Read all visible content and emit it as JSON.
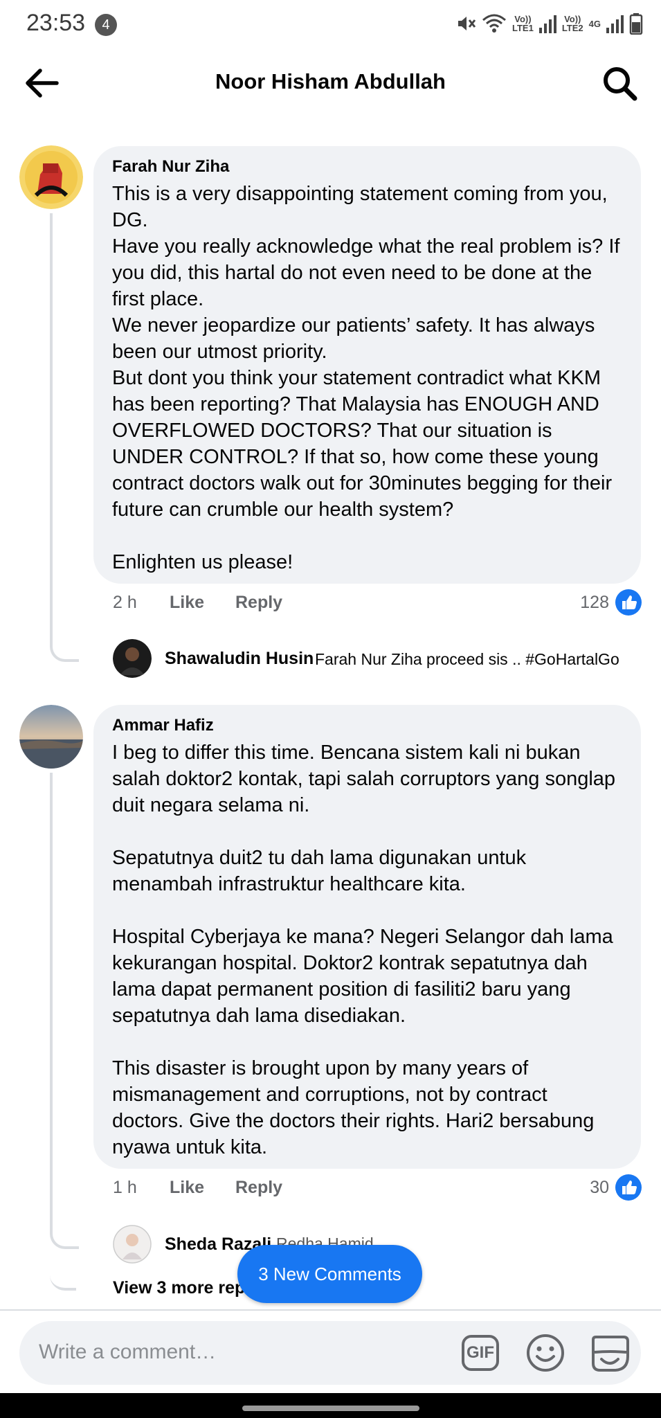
{
  "status_bar": {
    "time": "23:53",
    "notification_count": "4",
    "sim1_label_top": "Vo))",
    "sim1_label_bottom": "LTE1",
    "sim2_label_top": "Vo))",
    "sim2_label_bottom": "LTE2",
    "network_type": "4G",
    "icons": [
      "mute-icon",
      "wifi-icon",
      "signal-icon",
      "battery-icon"
    ]
  },
  "header": {
    "title": "Noor Hisham Abdullah",
    "back_icon": "arrow-left-icon",
    "search_icon": "search-icon"
  },
  "comments": [
    {
      "author": "Farah Nur Ziha",
      "text": "This is a very disappointing statement coming from you, DG.\nHave you really acknowledge what the real problem is? If you did, this hartal do not even need to be done at the first place.\nWe never jeopardize our patients’ safety. It has always been our utmost priority.\nBut dont you think your statement contradict what KKM has been reporting? That Malaysia has ENOUGH AND OVERFLOWED DOCTORS? That our situation is UNDER CONTROL? If that so, how come these young contract doctors walk out for 30minutes begging for their future can crumble our health system?\n\nEnlighten us please!",
      "time": "2 h",
      "like_label": "Like",
      "reply_label": "Reply",
      "reaction_count": "128",
      "reply_preview": {
        "author": "Shawaludin Husin",
        "text": "Farah Nur Ziha proceed sis  .. #GoHartalGo"
      }
    },
    {
      "author": "Ammar Hafiz",
      "text": "I beg to differ this time. Bencana sistem kali ni bukan salah doktor2 kontak, tapi salah corruptors yang songlap duit negara selama ni.\n\nSepatutnya duit2 tu dah lama digunakan untuk menambah infrastruktur healthcare kita.\n\nHospital Cyberjaya ke mana? Negeri Selangor dah lama kekurangan hospital. Doktor2 kontrak sepatutnya dah lama dapat permanent position di fasiliti2 baru yang sepatutnya dah lama disediakan.\n\nThis disaster is brought upon by many years of mismanagement and corruptions, not by contract doctors. Give the doctors their rights. Hari2 bersabung nyawa untuk kita.",
      "time": "1 h",
      "like_label": "Like",
      "reply_label": "Reply",
      "reaction_count": "30",
      "reply_preview": {
        "author": "Sheda Razali",
        "text": "Redha Hamid"
      },
      "view_more_label": "View 3 more rep"
    }
  ],
  "new_comments_pill": "3 New Comments",
  "composer": {
    "placeholder": "Write a comment…",
    "gif_label": "GIF",
    "icons": [
      "gif-icon",
      "emoji-icon",
      "sticker-icon"
    ]
  },
  "colors": {
    "accent": "#1877f2",
    "bubble": "#f0f2f5",
    "secondary_text": "#65676b"
  }
}
